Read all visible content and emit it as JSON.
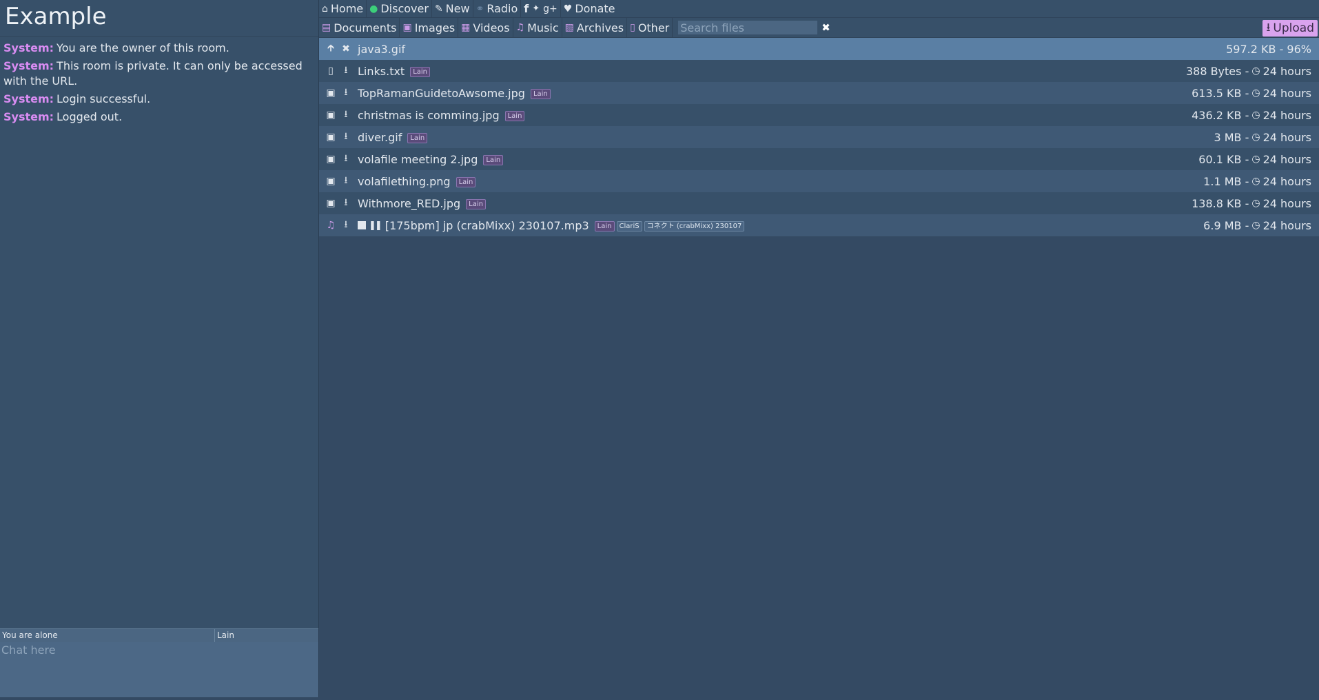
{
  "room": {
    "title": "Example"
  },
  "chat": {
    "messages": [
      {
        "user": "System:",
        "text": "You are the owner of this room."
      },
      {
        "user": "System:",
        "text": "This room is private. It can only be accessed with the URL."
      },
      {
        "user": "System:",
        "text": "Login successful."
      },
      {
        "user": "System:",
        "text": "Logged out."
      }
    ],
    "status": "You are alone",
    "username": "Lain",
    "placeholder": "Chat here"
  },
  "nav": {
    "home": "Home",
    "discover": "Discover",
    "new": "New",
    "radio": "Radio",
    "donate": "Donate"
  },
  "filters": {
    "documents": "Documents",
    "images": "Images",
    "videos": "Videos",
    "music": "Music",
    "archives": "Archives",
    "other": "Other",
    "search_placeholder": "Search files",
    "upload": "Upload"
  },
  "files": [
    {
      "name": "java3.gif",
      "meta": "597.2 KB - 96%",
      "uploading": true
    },
    {
      "name": "Links.txt",
      "tag": "Lain",
      "size": "388 Bytes -",
      "ttl": "24 hours"
    },
    {
      "name": "TopRamanGuidetoAwsome.jpg",
      "tag": "Lain",
      "size": "613.5 KB -",
      "ttl": "24 hours"
    },
    {
      "name": "christmas is comming.jpg",
      "tag": "Lain",
      "size": "436.2 KB -",
      "ttl": "24 hours"
    },
    {
      "name": "diver.gif",
      "tag": "Lain",
      "size": "3 MB -",
      "ttl": "24 hours"
    },
    {
      "name": "volafile meeting 2.jpg",
      "tag": "Lain",
      "size": "60.1 KB -",
      "ttl": "24 hours"
    },
    {
      "name": "volafilething.png",
      "tag": "Lain",
      "size": "1.1 MB -",
      "ttl": "24 hours"
    },
    {
      "name": "Withmore_RED.jpg",
      "tag": "Lain",
      "size": "138.8 KB -",
      "ttl": "24 hours"
    },
    {
      "name": "[175bpm] jp (crabMixx) 230107.mp3",
      "tag": "Lain",
      "tag2": "ClariS",
      "tag3": "コネクト (crabMixx) 230107",
      "size": "6.9 MB -",
      "ttl": "24 hours"
    }
  ]
}
